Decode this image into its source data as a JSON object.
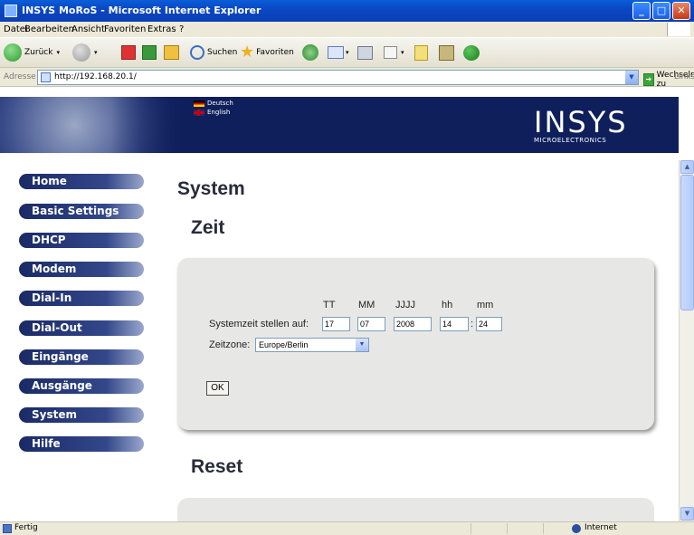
{
  "window": {
    "title": "INSYS MoRoS - Microsoft Internet Explorer",
    "min": "_",
    "max": "□",
    "close": "✕"
  },
  "menu": [
    "Datei",
    "Bearbeiten",
    "Ansicht",
    "Favoriten",
    "Extras",
    "?"
  ],
  "toolbar": {
    "back": "Zurück",
    "search": "Suchen",
    "favorites": "Favoriten"
  },
  "address": {
    "label": "Adresse",
    "url": "http://192.168.20.1/",
    "go": "Wechseln zu",
    "links": "Links"
  },
  "banner": {
    "lang_de": "Deutsch",
    "lang_en": "English",
    "logo": "INSYS",
    "logo_sub": "MICROELECTRONICS"
  },
  "nav": [
    "Home",
    "Basic Settings",
    "DHCP",
    "Modem",
    "Dial-In",
    "Dial-Out",
    "Eingänge",
    "Ausgänge",
    "System",
    "Hilfe"
  ],
  "main": {
    "title": "System",
    "section_time": "Zeit",
    "section_reset": "Reset",
    "col_tt": "TT",
    "col_mm": "MM",
    "col_jjjj": "JJJJ",
    "col_hh": "hh",
    "col_min": "mm",
    "set_time_label": "Systemzeit stellen auf:",
    "day": "17",
    "month": "07",
    "year": "2008",
    "hour": "14",
    "time_sep": ":",
    "minute": "24",
    "timezone_label": "Zeitzone:",
    "timezone": "Europe/Berlin",
    "ok": "OK"
  },
  "status": {
    "ready": "Fertig",
    "zone": "Internet"
  }
}
